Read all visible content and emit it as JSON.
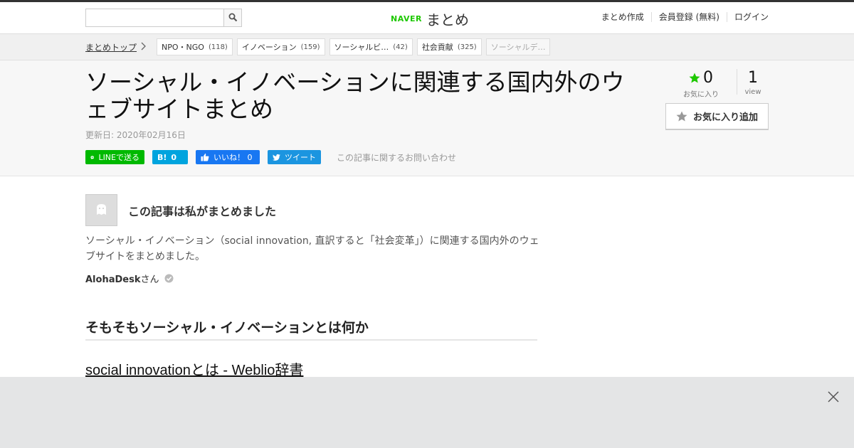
{
  "topbar": {
    "search_placeholder": "",
    "logo_naver": "NAVER",
    "logo_matome": "まとめ",
    "links": [
      "まとめ作成",
      "会員登録 (無料)",
      "ログイン"
    ]
  },
  "breadcrumb": {
    "top": "まとめトップ",
    "tags": [
      {
        "label": "NPO・NGO",
        "count": "(118)"
      },
      {
        "label": "イノベーション",
        "count": "(159)"
      },
      {
        "label": "ソーシャルビ…",
        "count": "(42)"
      },
      {
        "label": "社会貢献",
        "count": "(325)"
      },
      {
        "label": "ソーシャルデ…",
        "count": ""
      }
    ]
  },
  "article": {
    "title": "ソーシャル・イノベーションに関連する国内外のウェブサイトまとめ",
    "updated": "更新日: 2020年02月16日",
    "share": {
      "line": "LINEで送る",
      "hatena_count": "0",
      "fb": "いいね！ 0",
      "tw": "ツイート",
      "contact": "この記事に関するお問い合わせ"
    },
    "stats": {
      "fav_count": "0",
      "fav_label": "お気に入り",
      "view_count": "1",
      "view_label": "view"
    },
    "fav_button": "お気に入り追加",
    "author_heading": "この記事は私がまとめました",
    "description": "ソーシャル・イノベーション（social innovation, 直訳すると「社会変革」）に関連する国内外のウェブサイトをまとめました。",
    "author_name": "AlohaDesk",
    "author_suffix": "さん",
    "section_heading": "そもそもソーシャル・イノベーションとは何か",
    "link_heading": "social innovationとは - Weblio辞書"
  },
  "colors": {
    "naver_green": "#1ec800",
    "line_green": "#00b900",
    "hatena_blue": "#00a4de",
    "fb_blue": "#1877f2",
    "tw_blue": "#1b95e0"
  }
}
